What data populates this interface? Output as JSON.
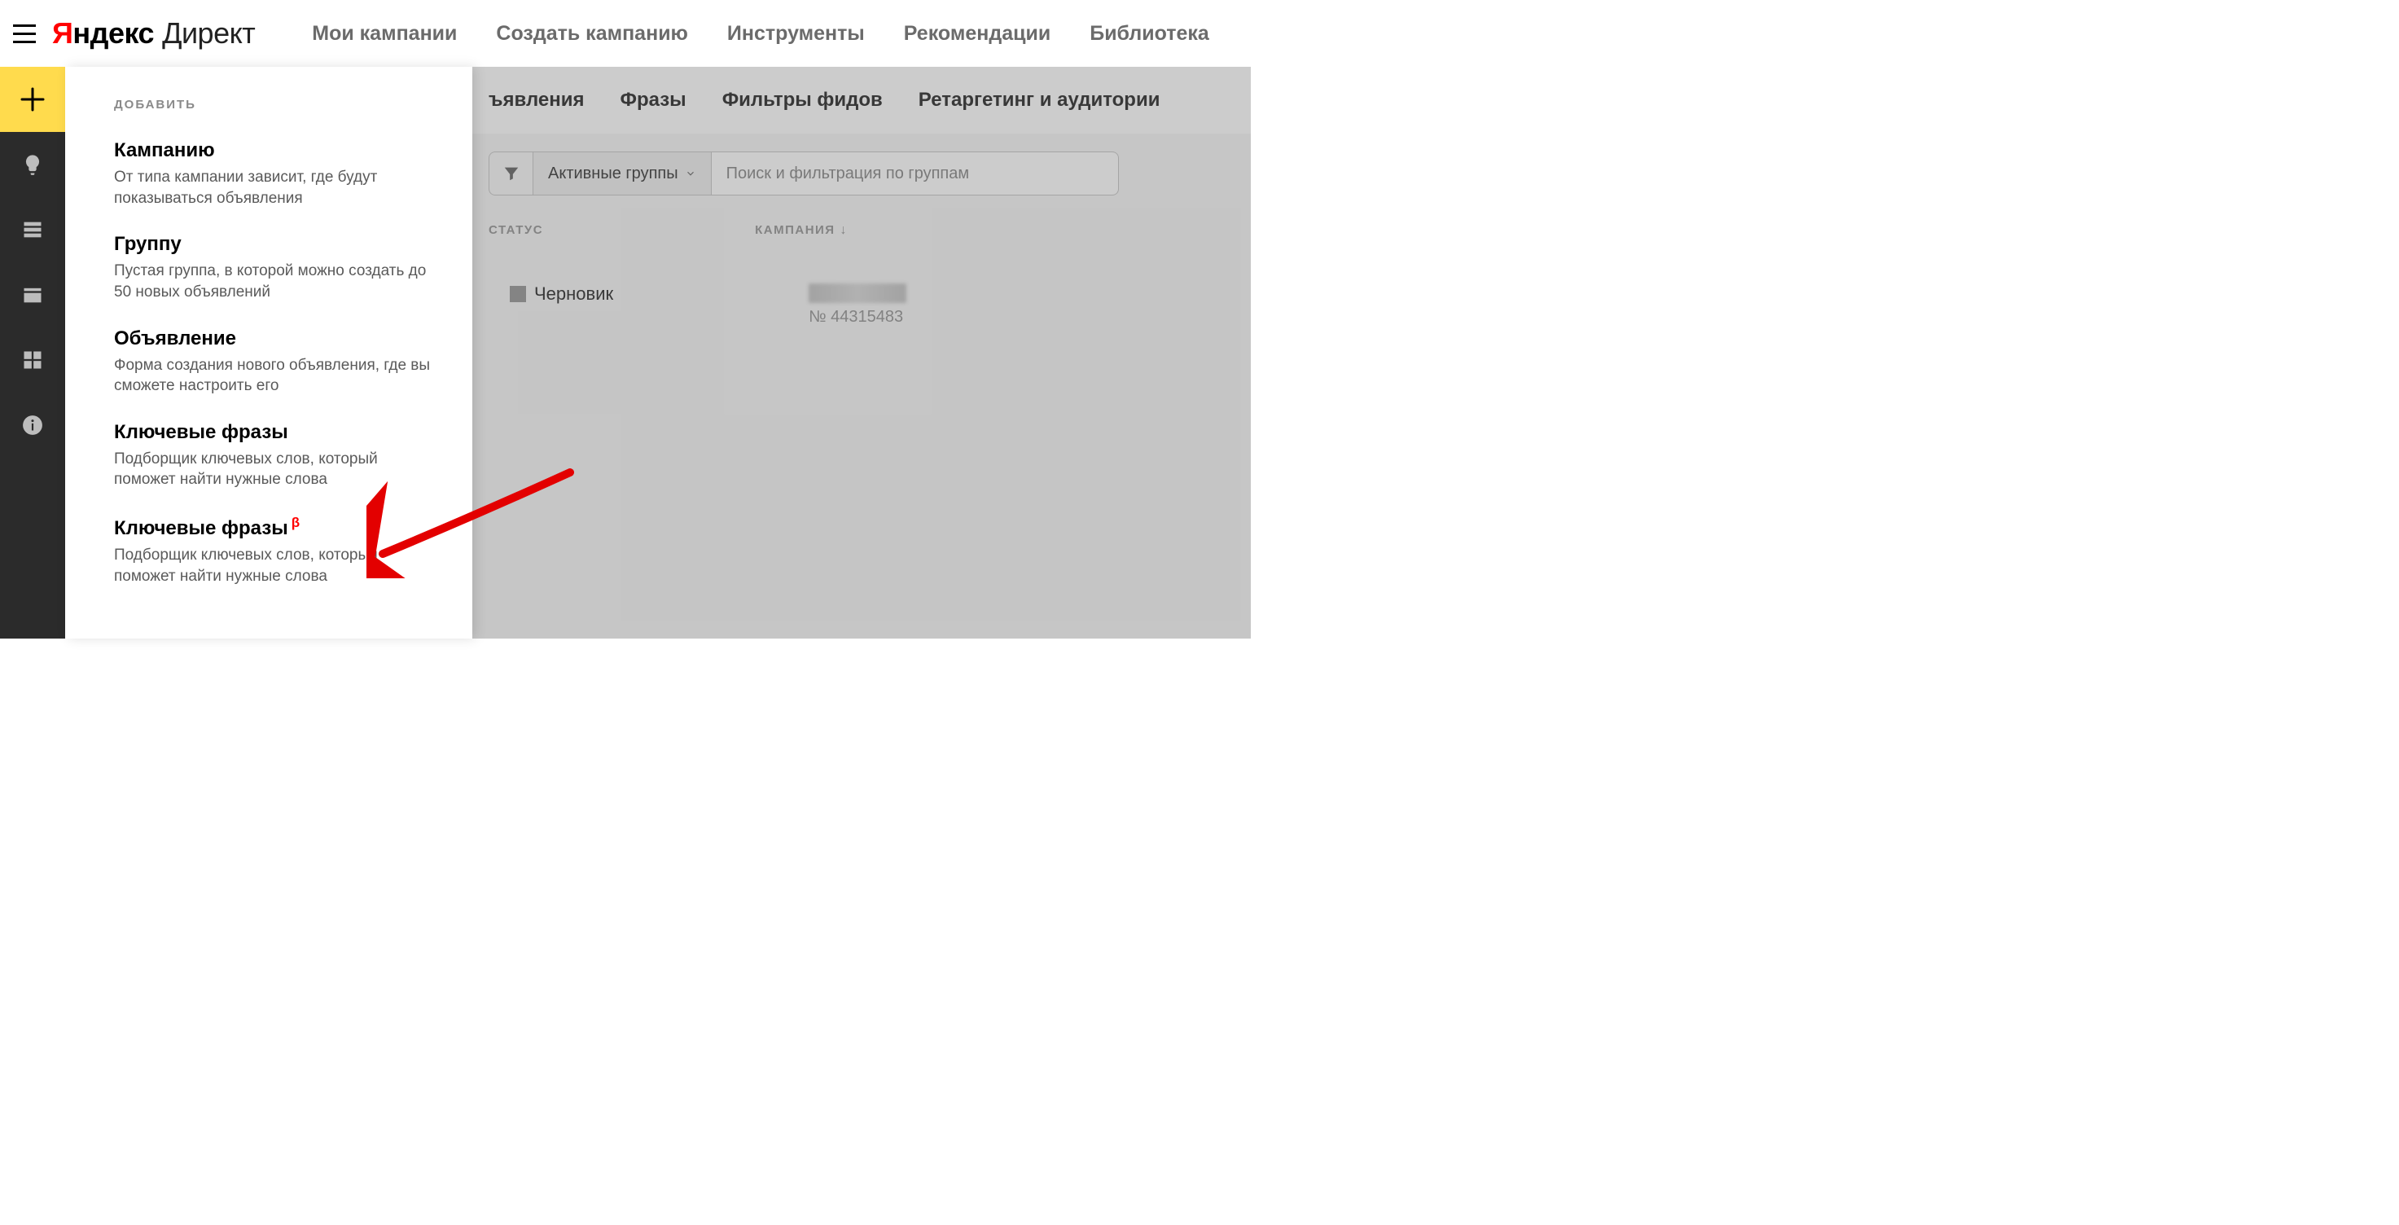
{
  "header": {
    "logo_prefix_first": "Я",
    "logo_prefix_rest": "ндекс",
    "logo_suffix": "Директ"
  },
  "topnav": [
    "Мои кампании",
    "Создать кампанию",
    "Инструменты",
    "Рекомендации",
    "Библиотека"
  ],
  "flyout": {
    "heading": "ДОБАВИТЬ",
    "items": [
      {
        "title": "Кампанию",
        "desc": "От типа кампании зависит, где будут показываться объявления",
        "beta": false
      },
      {
        "title": "Группу",
        "desc": "Пустая группа, в которой можно создать до 50 новых объявлений",
        "beta": false
      },
      {
        "title": "Объявление",
        "desc": "Форма создания нового объявления, где вы сможете настроить его",
        "beta": false
      },
      {
        "title": "Ключевые фразы",
        "desc": "Подборщик ключевых слов, который поможет найти нужные слова",
        "beta": false
      },
      {
        "title": "Ключевые фразы",
        "desc": "Подборщик ключевых слов, который поможет найти нужные слова",
        "beta": true
      }
    ],
    "beta_symbol": "β"
  },
  "subtabs": {
    "partial": "ъявления",
    "tabs": [
      "Фразы",
      "Фильтры фидов",
      "Ретаргетинг и аудитории"
    ]
  },
  "filter": {
    "chip": "Активные группы",
    "placeholder": "Поиск и фильтрация по группам"
  },
  "table": {
    "col_status": "СТАТУС",
    "col_campaign": "КАМПАНИЯ",
    "rows": [
      {
        "status": "Черновик",
        "campaign_num": "№ 44315483"
      }
    ]
  }
}
